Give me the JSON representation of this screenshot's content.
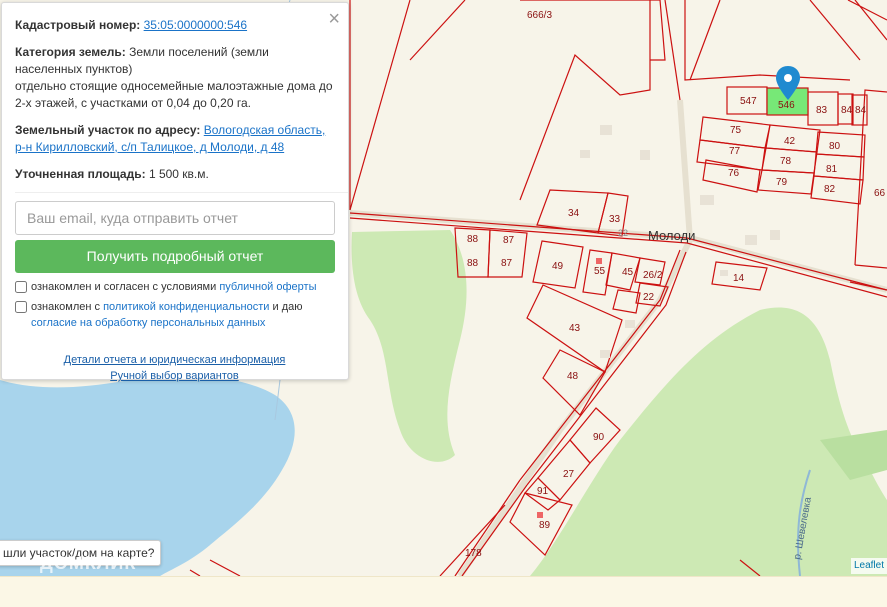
{
  "card": {
    "cadastral_label": "Кадастровый номер:",
    "cadastral_number": "35:05:0000000:546",
    "category_label": "Категория земель:",
    "category_value": "Земли поселений (земли населенных пунктов)",
    "usage_value": "отдельно стоящие односемейные малоэтажные дома до 2-х этажей, с участками от 0,04 до 0,20 га.",
    "address_label": "Земельный участок по адресу:",
    "address_value": "Вологодская область, р-н Кирилловский, с/п Талицкое, д Молоди, д 48",
    "area_label": "Уточненная площадь:",
    "area_value": "1 500 кв.м.",
    "email_placeholder": "Ваш email, куда отправить отчет",
    "submit_label": "Получить подробный отчет",
    "consent1_text": "ознакомлен и согласен с условиями ",
    "consent1_link": "публичной оферты",
    "consent2_text": "ознакомлен с ",
    "consent2_link": "политикой конфиденциальности",
    "consent2_text2": " и даю ",
    "consent2_link2": "согласие на обработку персональных данных",
    "details_link": "Детали отчета и юридическая информация",
    "manual_link": "Ручной выбор вариантов",
    "close_icon": "×"
  },
  "map": {
    "village": "Молоди",
    "river": "р. Шевелевка",
    "street_22": "22",
    "tooltip": "шли участок/дом на карте?",
    "watermark": "ДОМКЛИК",
    "attribution": "Leaflet",
    "selected_plot": "546",
    "plot_labels": {
      "p666_3": "666/3",
      "p547": "547",
      "p546": "546",
      "p83": "83",
      "p84a": "84",
      "p84b": "84",
      "p75": "75",
      "p42": "42",
      "p80": "80",
      "p77": "77",
      "p78": "78",
      "p81": "81",
      "p76": "76",
      "p79": "79",
      "p82": "82",
      "p66": "66",
      "p34": "34",
      "p33": "33",
      "p88a": "88",
      "p87a": "87",
      "p88b": "88",
      "p87b": "87",
      "p49": "49",
      "p55": "55",
      "p45": "45",
      "p26_2": "26/2",
      "p22": "22",
      "p14": "14",
      "p43": "43",
      "p48": "48",
      "p90": "90",
      "p27": "27",
      "p91": "91",
      "p89": "89",
      "p178": "178"
    },
    "colors": {
      "boundary": "#cc1111",
      "selected": "#77e877",
      "water": "#a8d4ec",
      "forest": "#cde9b4",
      "marker": "#1f8ad0"
    }
  }
}
